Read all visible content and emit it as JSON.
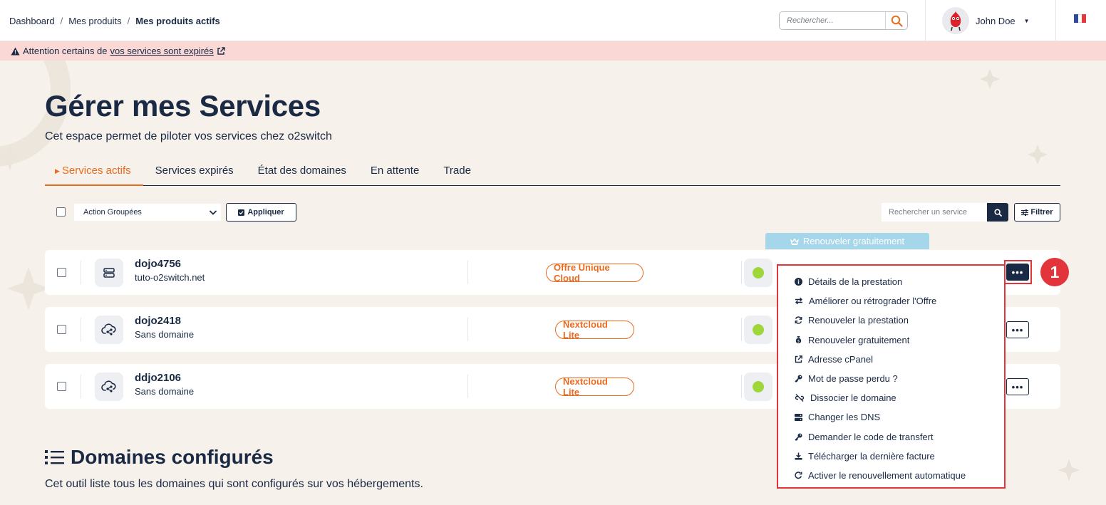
{
  "breadcrumb": {
    "items": [
      "Dashboard",
      "Mes produits"
    ],
    "current": "Mes produits actifs",
    "separator": "/"
  },
  "header": {
    "search_placeholder": "Rechercher...",
    "user_name": "John Doe",
    "language": "fr"
  },
  "alert": {
    "prefix": "Attention certains de",
    "link": "vos services sont expirés"
  },
  "page": {
    "title": "Gérer mes Services",
    "subtitle": "Cet espace permet de piloter vos services chez o2switch"
  },
  "tabs": [
    {
      "label": "Services actifs",
      "active": true
    },
    {
      "label": "Services expirés",
      "active": false
    },
    {
      "label": "État des domaines",
      "active": false
    },
    {
      "label": "En attente",
      "active": false
    },
    {
      "label": "Trade",
      "active": false
    }
  ],
  "toolbar": {
    "bulk_action_selected": "Action Groupées",
    "apply_label": "Appliquer",
    "service_search_placeholder": "Rechercher un service",
    "filter_label": "Filtrer"
  },
  "renew_badge": "Renouveler gratuitement",
  "services": [
    {
      "name": "dojo4756",
      "domain": "tuto-o2switch.net",
      "offer": "Offre Unique Cloud",
      "icon": "server-icon",
      "status": "active"
    },
    {
      "name": "dojo2418",
      "domain": "Sans domaine",
      "offer": "Nextcloud Lite",
      "icon": "cloud-share-icon",
      "status": "active"
    },
    {
      "name": "ddjo2106",
      "domain": "Sans domaine",
      "offer": "Nextcloud Lite",
      "icon": "cloud-share-icon",
      "status": "active"
    }
  ],
  "more_button": "•••",
  "step_badge": "1",
  "dropdown": [
    {
      "label": "Détails de la prestation",
      "icon": "info-circle-icon"
    },
    {
      "label": "Améliorer ou rétrograder l'Offre",
      "icon": "exchange-icon"
    },
    {
      "label": "Renouveler la prestation",
      "icon": "refresh-icon"
    },
    {
      "label": "Renouveler gratuitement",
      "icon": "money-bag-icon"
    },
    {
      "label": "Adresse cPanel",
      "icon": "external-link-icon"
    },
    {
      "label": "Mot de passe perdu ?",
      "icon": "key-icon"
    },
    {
      "label": "Dissocier le domaine",
      "icon": "unlink-icon"
    },
    {
      "label": "Changer les DNS",
      "icon": "server-icon"
    },
    {
      "label": "Demander le code de transfert",
      "icon": "key-icon"
    },
    {
      "label": "Télécharger la dernière facture",
      "icon": "download-icon"
    },
    {
      "label": "Activer le renouvellement automatique",
      "icon": "redo-icon"
    }
  ],
  "domains_section": {
    "title": "Domaines configurés",
    "subtitle": "Cet outil liste tous les domaines qui sont configurés sur vos hébergements."
  },
  "colors": {
    "navy": "#1b2a44",
    "orange": "#ea6a1f",
    "alert_bg": "#f9d8d6",
    "status_green": "#9fd63a",
    "highlight_red": "#e2343b",
    "renew_blue": "#a6d6ea"
  }
}
